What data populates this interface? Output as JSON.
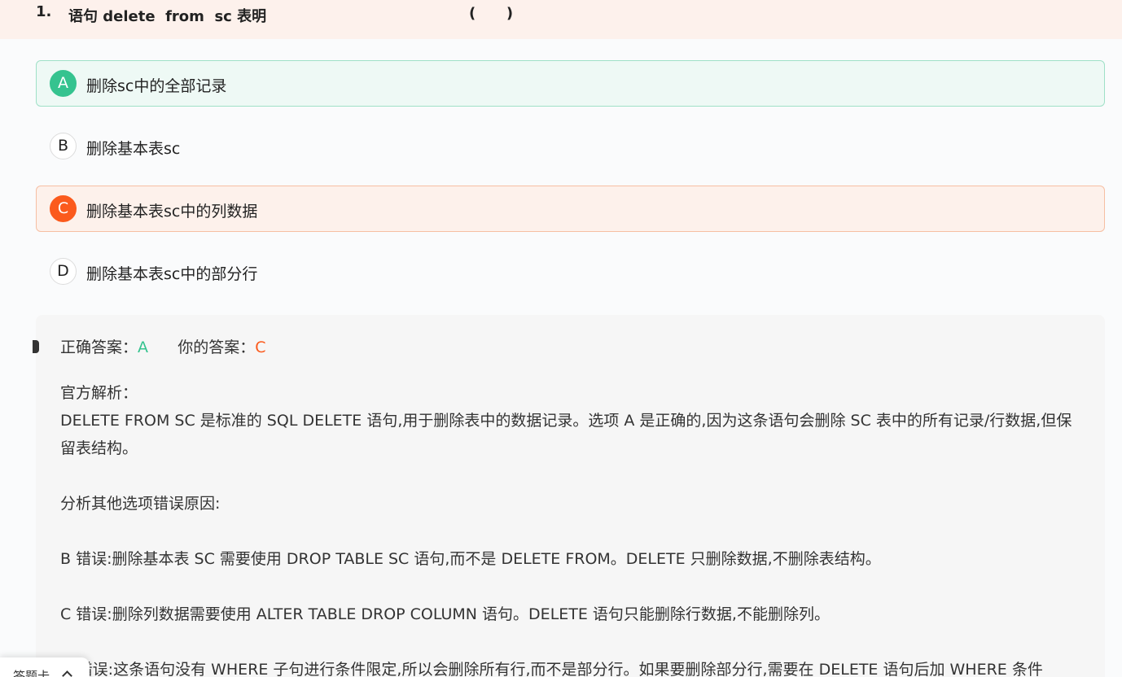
{
  "question": {
    "number": "1.",
    "stem": "语句 delete  from  sc 表明",
    "blank": "(      )"
  },
  "options": [
    {
      "key": "A",
      "text": "删除sc中的全部记录",
      "state": "correct"
    },
    {
      "key": "B",
      "text": "删除基本表sc",
      "state": "normal"
    },
    {
      "key": "C",
      "text": "删除基本表sc中的列数据",
      "state": "wrong"
    },
    {
      "key": "D",
      "text": "删除基本表sc中的部分行",
      "state": "normal"
    }
  ],
  "result": {
    "correct_label": "正确答案：",
    "correct_value": "A",
    "your_label": "你的答案：",
    "your_value": "C"
  },
  "analysis": {
    "title": "官方解析：",
    "paragraph1": "DELETE FROM SC 是标准的 SQL DELETE 语句,用于删除表中的数据记录。选项 A 是正确的,因为这条语句会删除 SC 表中的所有记录/行数据,但保留表结构。",
    "paragraph2": "分析其他选项错误原因:",
    "paragraph3": "B 错误:删除基本表 SC 需要使用 DROP TABLE SC 语句,而不是 DELETE FROM。DELETE 只删除数据,不删除表结构。",
    "paragraph4": "C 错误:删除列数据需要使用 ALTER TABLE DROP COLUMN 语句。DELETE 语句只能删除行数据,不能删除列。",
    "paragraph5": "D 错误:这条语句没有 WHERE 子句进行条件限定,所以会删除所有行,而不是部分行。如果要删除部分行,需要在 DELETE 语句后加 WHERE 条件"
  },
  "bottom_tab": {
    "label": "答题卡",
    "icon": "chevron-up-icon"
  },
  "colors": {
    "correct": "#35c38f",
    "wrong": "#fb5a1c",
    "header_bg": "#fdf1ec"
  }
}
